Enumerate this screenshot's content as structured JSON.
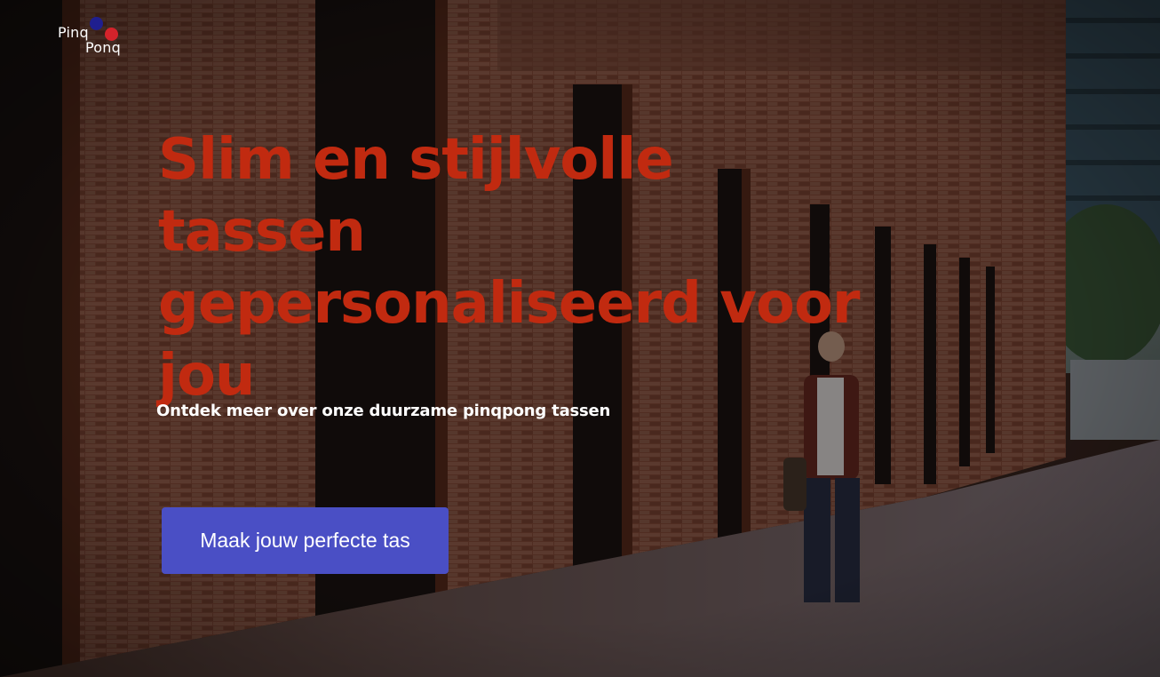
{
  "logo": {
    "line1": "Pinq",
    "line2": "Ponq",
    "dot_colors": [
      "#1f1f8f",
      "#d4232b"
    ]
  },
  "hero": {
    "headline": "Slim en stijlvolle tassen gepersonaliseerd voor jou",
    "subtitle": "Ontdek meer over onze duurzame pinqpong tassen",
    "cta_label": "Maak jouw perfecte tas",
    "background": "photo-brick-building-walking-man"
  },
  "colors": {
    "headline": "#c12a10",
    "cta_background": "#4a4fc5",
    "text": "#ffffff"
  }
}
